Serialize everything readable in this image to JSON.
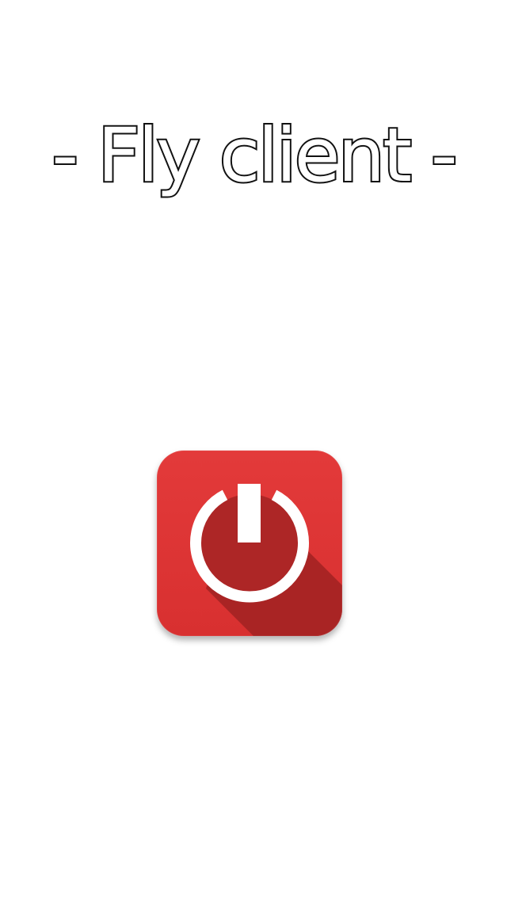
{
  "app": {
    "title": "- Fly client -"
  },
  "power_button": {
    "icon": "power-icon",
    "colors": {
      "tile": "#e03434",
      "tile_shade": "#a92424",
      "symbol": "#ffffff"
    }
  }
}
